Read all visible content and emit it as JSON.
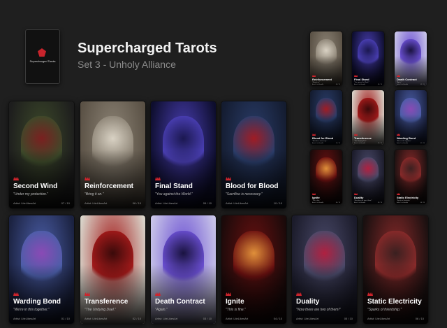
{
  "header": {
    "title": "Supercharged Tarots",
    "subtitle": "Set 3 - Unholy Alliance",
    "deck_label": "Supercharged Tarots"
  },
  "cards": [
    {
      "name": "Second Wind",
      "quote": "\"Under my protection.\"",
      "artist": "Artist: LiteLikesArt",
      "number": "07 / 10",
      "colors": [
        "#3d4a2a",
        "#7a2020",
        "#1d1d1d"
      ]
    },
    {
      "name": "Reinforcement",
      "quote": "\"Bring it on.\"",
      "artist": "Artist: LiteLikesArt",
      "number": "08 / 10",
      "colors": [
        "#8d8476",
        "#d9d2c4",
        "#5a5145"
      ]
    },
    {
      "name": "Final Stand",
      "quote": "\"You against the World.\"",
      "artist": "Artist: LiteLikesArt",
      "number": "09 / 10",
      "colors": [
        "#4a3fb4",
        "#1b1850",
        "#0e0e2e"
      ]
    },
    {
      "name": "Blood for Blood",
      "quote": "\"Sacrifice is necessary.\"",
      "artist": "Artist: LiteLikesArt",
      "number": "10 / 10",
      "colors": [
        "#2a3d6a",
        "#a01c24",
        "#141c30"
      ]
    },
    {
      "name": "Warding Bond",
      "quote": "\"We're in this together.\"",
      "artist": "Artist: LiteLikesArt",
      "number": "01 / 10",
      "colors": [
        "#4b5ea8",
        "#8a4ab5",
        "#1b2240"
      ]
    },
    {
      "name": "Transference",
      "quote": "\"The Undying Duel.\"",
      "artist": "Artist: LiteLikesArt",
      "number": "02 / 10",
      "colors": [
        "#a31a1a",
        "#3a0a0a",
        "#d8d2c8"
      ]
    },
    {
      "name": "Death Contract",
      "quote": "\"Again.\"",
      "artist": "Artist: LiteLikesArt",
      "number": "03 / 10",
      "colors": [
        "#6a4fd2",
        "#1a1340",
        "#c8c4e8"
      ]
    },
    {
      "name": "Ignite",
      "quote": "\"This is fine.\"",
      "artist": "Artist: LiteLikesArt",
      "number": "04 / 10",
      "colors": [
        "#6a1010",
        "#e0903a",
        "#1a0a0a"
      ]
    },
    {
      "name": "Duality",
      "quote": "\"Now there are two of them!\"",
      "artist": "Artist: LiteLikesArt",
      "number": "05 / 10",
      "colors": [
        "#4a4a6a",
        "#b02040",
        "#1b1b2a"
      ]
    },
    {
      "name": "Static Electricity",
      "quote": "\"Sparks of friendship.\"",
      "artist": "Artist: LiteLikesArt",
      "number": "06 / 10",
      "colors": [
        "#8a2a2a",
        "#3a2020",
        "#1a1010"
      ]
    }
  ]
}
